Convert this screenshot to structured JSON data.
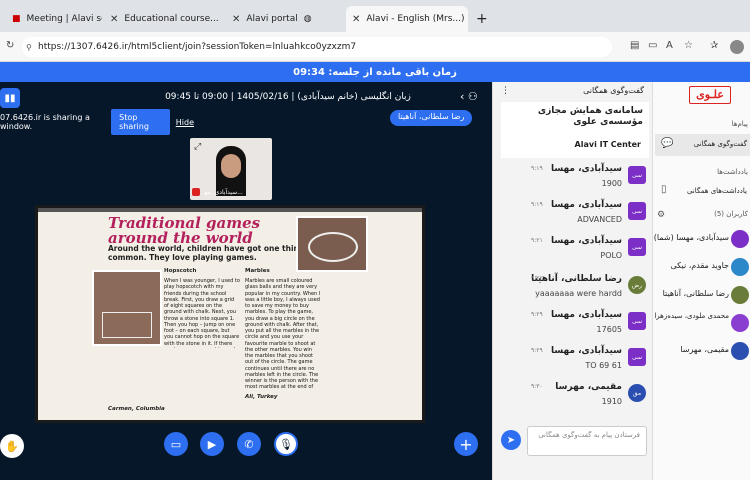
{
  "browser": {
    "tabs": [
      {
        "label": "Meeting | Alavi school..."
      },
      {
        "label": "Educational course..."
      },
      {
        "label": "Alavi portal"
      },
      {
        "label": "Alavi - English (Mrs...)"
      }
    ],
    "new_tab": "+",
    "url": "https://1307.6426.ir/html5client/join?sessionToken=lnluahkco0yzxzm7"
  },
  "time_remaining": "زمان باقی مانده از جلسه: 09:34",
  "meeting": {
    "title": "زبان انگلیسی (خانم سیدآبادی) | 1405/02/16 | 09:00 تا 09:45",
    "presenter_tag": "رضا سلطانی، آناهیتا",
    "sharing_notice": "07.6426.ir is sharing a window.",
    "stop_sharing": "Stop sharing",
    "hide": "Hide",
    "webcam_label": "سیدآبادی، مهـ..."
  },
  "book": {
    "title_line1": "Traditional games",
    "title_line2": "around the world",
    "subtitle": "Around the world, children have got one thing in common. They love playing games.",
    "h_hopscotch": "Hopscotch",
    "h_marbles": "Marbles",
    "hopscotch_text": "When I was younger, I used to play hopscotch with my friends during the school break. First, you draw a grid of eight squares on the ground with chalk. Next, you throw a stone into square 1. Then you hop – jump on one foot – on each square, but you cannot hop on the square with the stone in it. If there are two squares next to each other, you can put both feet down. You must hop from squares 1 to 8 and back again without falling. When it's your turn again, you have to throw the stone into square 2 and hop all over again. The winner is the player who throws the stone in all eight squares and hops without falling.",
    "hopscotch_author": "Carmen, Columbia",
    "marbles_text": "Marbles are small coloured glass balls and they are very popular in my country. When I was a little boy, I always used to save my money to buy marbles. To play the game, you draw a big circle on the ground with chalk. After that, you put all the marbles in the circle and you use your favourite marble to shoot at the other marbles. You win the marbles that you shoot out of the circle. The game continues until there are no marbles left in the circle. The winner is the person with the most marbles at the end of the game.",
    "marbles_author": "Ali, Turkey"
  },
  "chat": {
    "header": "گفت‌وگوی همگانی",
    "welcome_title": "سامانه‌ی همایش مجازی مؤسسه‌ی علوی",
    "welcome_sub": "Alavi IT Center",
    "messages": [
      {
        "avatar": "سی",
        "name": "سیدآبادی، مهسا",
        "time": "۹:۱۹",
        "text": "1900"
      },
      {
        "avatar": "سی",
        "name": "سیدآبادی، مهسا",
        "time": "۹:۱۹",
        "text": "ADVANCED"
      },
      {
        "avatar": "سی",
        "name": "سیدآبادی، مهسا",
        "time": "۹:۲۱",
        "text": "POLO"
      },
      {
        "avatar": "رض",
        "name": "رضا سلطانی، آناهیتا",
        "time": "۹:۲۲",
        "text": "yaaaaaaa were hardd"
      },
      {
        "avatar": "سی",
        "name": "سیدآبادی، مهسا",
        "time": "۹:۲۹",
        "text": "17605"
      },
      {
        "avatar": "سی",
        "name": "سیدآبادی، مهسا",
        "time": "۹:۲۹",
        "text": "TO 69 61"
      },
      {
        "avatar": "مق",
        "name": "مقیمی، مهرسا",
        "time": "۹:۳۰",
        "text": "1910"
      }
    ],
    "input_placeholder": "فرستادن پیام به گفت‌وگوی همگانی"
  },
  "side": {
    "logo": "علـوی",
    "messages_label": "پیام‌ها",
    "public_chat": "گفت‌وگوی همگانی",
    "notes_label": "یادداشت‌ها",
    "shared_notes": "یادداشت‌های همگانی",
    "users_label": "کاربران (5)",
    "users": [
      {
        "name": "سیدآبادی، مهسا (شما)"
      },
      {
        "name": "جاوید مقدم، نیکی"
      },
      {
        "name": "رضا سلطانی، آناهیتا"
      },
      {
        "name": "محمدی ملودی، سیده‌زهرا"
      },
      {
        "name": "مقیمی، مهرسا"
      }
    ]
  },
  "colors": {
    "accent": "#2d6ff0",
    "stage": "#06172a",
    "avatar": "#7b2fc7"
  }
}
